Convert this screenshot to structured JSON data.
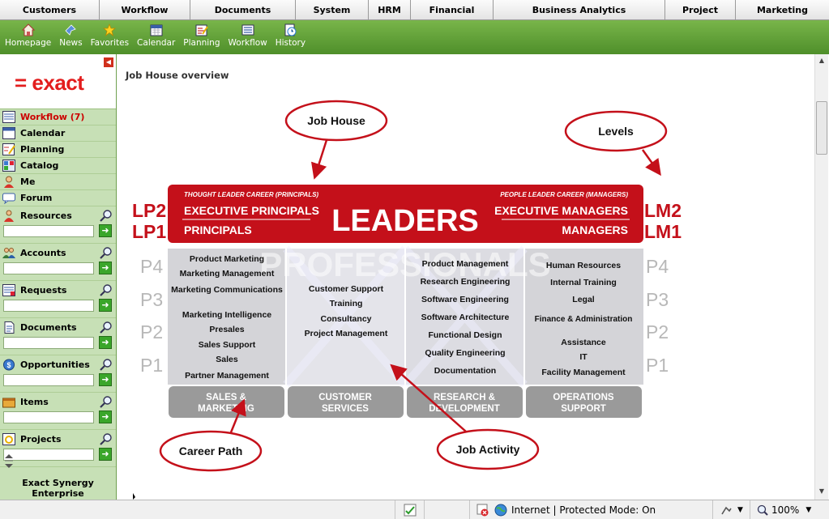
{
  "top_menu": [
    "Customers",
    "Workflow",
    "Documents",
    "System",
    "HRM",
    "Financial",
    "Business Analytics",
    "Project",
    "Marketing"
  ],
  "toolbar": [
    {
      "label": "Homepage",
      "icon": "home-icon"
    },
    {
      "label": "News",
      "icon": "news-icon"
    },
    {
      "label": "Favorites",
      "icon": "star-icon"
    },
    {
      "label": "Calendar",
      "icon": "calendar-icon"
    },
    {
      "label": "Planning",
      "icon": "planning-icon"
    },
    {
      "label": "Workflow",
      "icon": "workflow-icon"
    },
    {
      "label": "History",
      "icon": "history-icon"
    }
  ],
  "sidebar": {
    "logo": "= exact",
    "nav": [
      {
        "label": "Workflow (7)",
        "icon": "workflow-icon"
      },
      {
        "label": "Calendar",
        "icon": "calendar-icon"
      },
      {
        "label": "Planning",
        "icon": "planning-icon"
      },
      {
        "label": "Catalog",
        "icon": "catalog-icon"
      },
      {
        "label": "Me",
        "icon": "user-icon"
      },
      {
        "label": "Forum",
        "icon": "forum-icon"
      }
    ],
    "search_sections": [
      {
        "label": "Resources",
        "icon": "resources-icon"
      },
      {
        "label": "Accounts",
        "icon": "accounts-icon"
      },
      {
        "label": "Requests",
        "icon": "requests-icon"
      },
      {
        "label": "Documents",
        "icon": "documents-icon"
      },
      {
        "label": "Opportunities",
        "icon": "opportunities-icon"
      },
      {
        "label": "Items",
        "icon": "items-icon"
      },
      {
        "label": "Projects",
        "icon": "projects-icon"
      }
    ],
    "footer": [
      "Exact Synergy",
      "Enterprise"
    ]
  },
  "main": {
    "page_title": "Job House overview"
  },
  "diagram": {
    "callouts": {
      "job_house": "Job House",
      "levels": "Levels",
      "career_path": "Career Path",
      "job_activity": "Job Activity"
    },
    "leaders": {
      "left_sub": "THOUGHT LEADER CAREER (PRINCIPALS)",
      "right_sub": "PEOPLE LEADER CAREER (MANAGERS)",
      "left_top": "EXECUTIVE PRINCIPALS",
      "left_bottom": "PRINCIPALS",
      "center": "LEADERS",
      "right_top": "EXECUTIVE MANAGERS",
      "right_bottom": "MANAGERS"
    },
    "level_labels": {
      "lp2": "LP2",
      "lp1": "LP1",
      "lm2": "LM2",
      "lm1": "LM1"
    },
    "p_levels": [
      "P4",
      "P3",
      "P2",
      "P1"
    ],
    "watermark": "PROFESSIONALS",
    "columns": [
      {
        "items": [
          "Product Marketing",
          "Marketing Management",
          "Marketing Communications",
          "Marketing Intelligence",
          "Presales",
          "Sales Support",
          "Sales",
          "Partner Management"
        ],
        "footer": [
          "SALES &",
          "MARKETING"
        ]
      },
      {
        "items": [
          "Customer Support",
          "Training",
          "Consultancy",
          "Project Management"
        ],
        "footer": [
          "CUSTOMER",
          "SERVICES"
        ]
      },
      {
        "items": [
          "Product Management",
          "Research Engineering",
          "Software Engineering",
          "Software Architecture",
          "Functional Design",
          "Quality Engineering",
          "Documentation"
        ],
        "footer": [
          "RESEARCH &",
          "DEVELOPMENT"
        ]
      },
      {
        "items": [
          "Human Resources",
          "Internal Training",
          "Legal",
          "Finance & Administration",
          "Assistance",
          "IT",
          "Facility Management"
        ],
        "footer": [
          "OPERATIONS",
          "SUPPORT"
        ]
      }
    ]
  },
  "statusbar": {
    "zone": "Internet | Protected Mode: On",
    "zoom": "100%"
  }
}
